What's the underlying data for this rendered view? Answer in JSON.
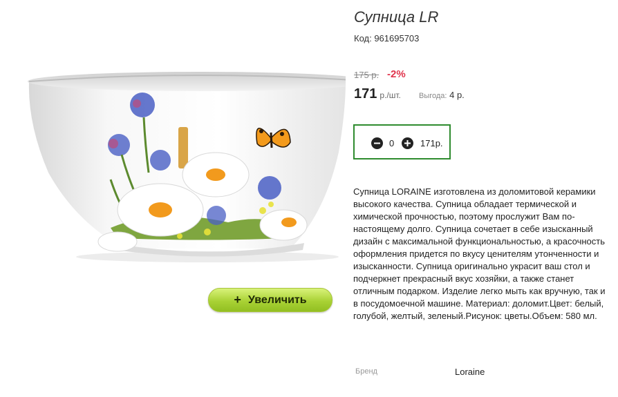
{
  "product": {
    "title": "Супница LR",
    "code": "Код: 961695703",
    "old_price": "175 р.",
    "discount": "-2%",
    "price": "171",
    "unit": "р./шт.",
    "benefit_label": "Выгода:",
    "benefit_value": "4 р."
  },
  "cart": {
    "quantity": "0",
    "sum": "171р."
  },
  "zoom_button": {
    "icon": "+",
    "label": "Увеличить"
  },
  "description": "Супница LORAINE изготовлена из доломитовой керамики высокого качества. Супница обладает термической и химической прочностью, поэтому прослужит Вам по-настоящему долго. Супница сочетает в себе изысканный дизайн с максимальной функциональностью, а красочность оформления придется по вкусу ценителям утонченности и изысканности. Супница оригинально украсит ваш стол и подчеркнет прекрасный вкус хозяйки, а также станет отличным подарком. Изделие легко мыть как вручную, так и в посудомоечной машине. Материал: доломит.Цвет: белый, голубой, желтый, зеленый.Рисунок: цветы.Объем: 580 мл.",
  "brand": {
    "label": "Бренд",
    "value": "Loraine"
  },
  "colors": {
    "accent_green": "#2e8b2e",
    "discount_red": "#e0344c",
    "button_green": "#a9d235"
  }
}
